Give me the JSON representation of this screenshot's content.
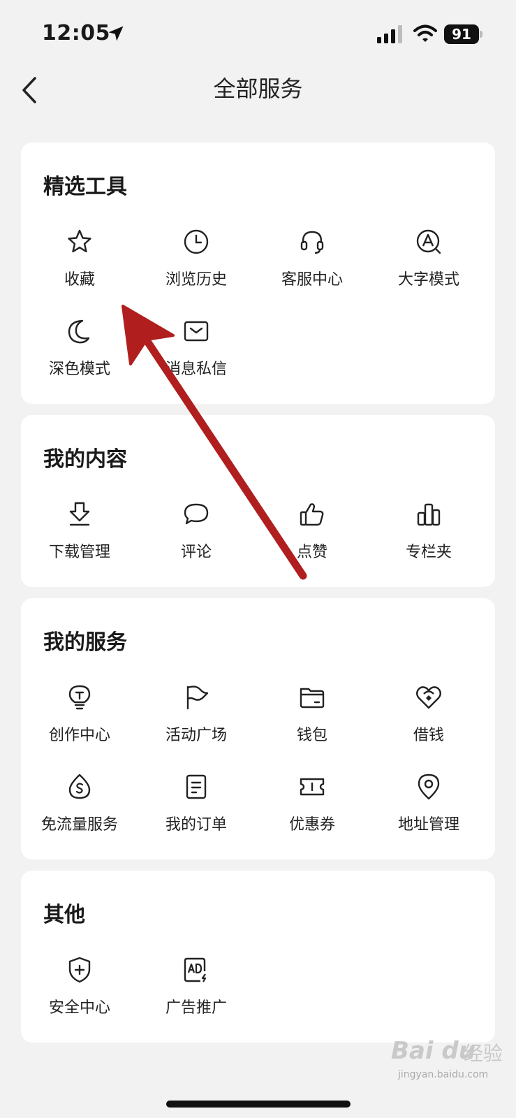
{
  "status": {
    "time": "12:05",
    "battery": "91"
  },
  "nav": {
    "title": "全部服务"
  },
  "sections": [
    {
      "title": "精选工具",
      "items": [
        {
          "label": "收藏",
          "icon": "star-icon"
        },
        {
          "label": "浏览历史",
          "icon": "clock-icon"
        },
        {
          "label": "客服中心",
          "icon": "headset-icon"
        },
        {
          "label": "大字模式",
          "icon": "font-size-icon"
        },
        {
          "label": "深色模式",
          "icon": "moon-icon"
        },
        {
          "label": "消息私信",
          "icon": "mail-icon"
        }
      ]
    },
    {
      "title": "我的内容",
      "items": [
        {
          "label": "下载管理",
          "icon": "download-icon"
        },
        {
          "label": "评论",
          "icon": "comment-icon"
        },
        {
          "label": "点赞",
          "icon": "thumbs-up-icon"
        },
        {
          "label": "专栏夹",
          "icon": "column-folder-icon"
        }
      ]
    },
    {
      "title": "我的服务",
      "items": [
        {
          "label": "创作中心",
          "icon": "lightbulb-icon"
        },
        {
          "label": "活动广场",
          "icon": "flag-icon"
        },
        {
          "label": "钱包",
          "icon": "wallet-icon"
        },
        {
          "label": "借钱",
          "icon": "loan-icon"
        },
        {
          "label": "免流量服务",
          "icon": "data-drop-icon"
        },
        {
          "label": "我的订单",
          "icon": "order-icon"
        },
        {
          "label": "优惠券",
          "icon": "coupon-icon"
        },
        {
          "label": "地址管理",
          "icon": "location-pin-icon"
        }
      ]
    },
    {
      "title": "其他",
      "items": [
        {
          "label": "安全中心",
          "icon": "shield-icon"
        },
        {
          "label": "广告推广",
          "icon": "ad-icon"
        }
      ]
    }
  ],
  "watermark": {
    "brand": "Bai du",
    "sub": "经验",
    "url": "jingyan.baidu.com"
  },
  "colors": {
    "background": "#f2f2f2",
    "card": "#ffffff",
    "annotation": "#b01e1e"
  }
}
